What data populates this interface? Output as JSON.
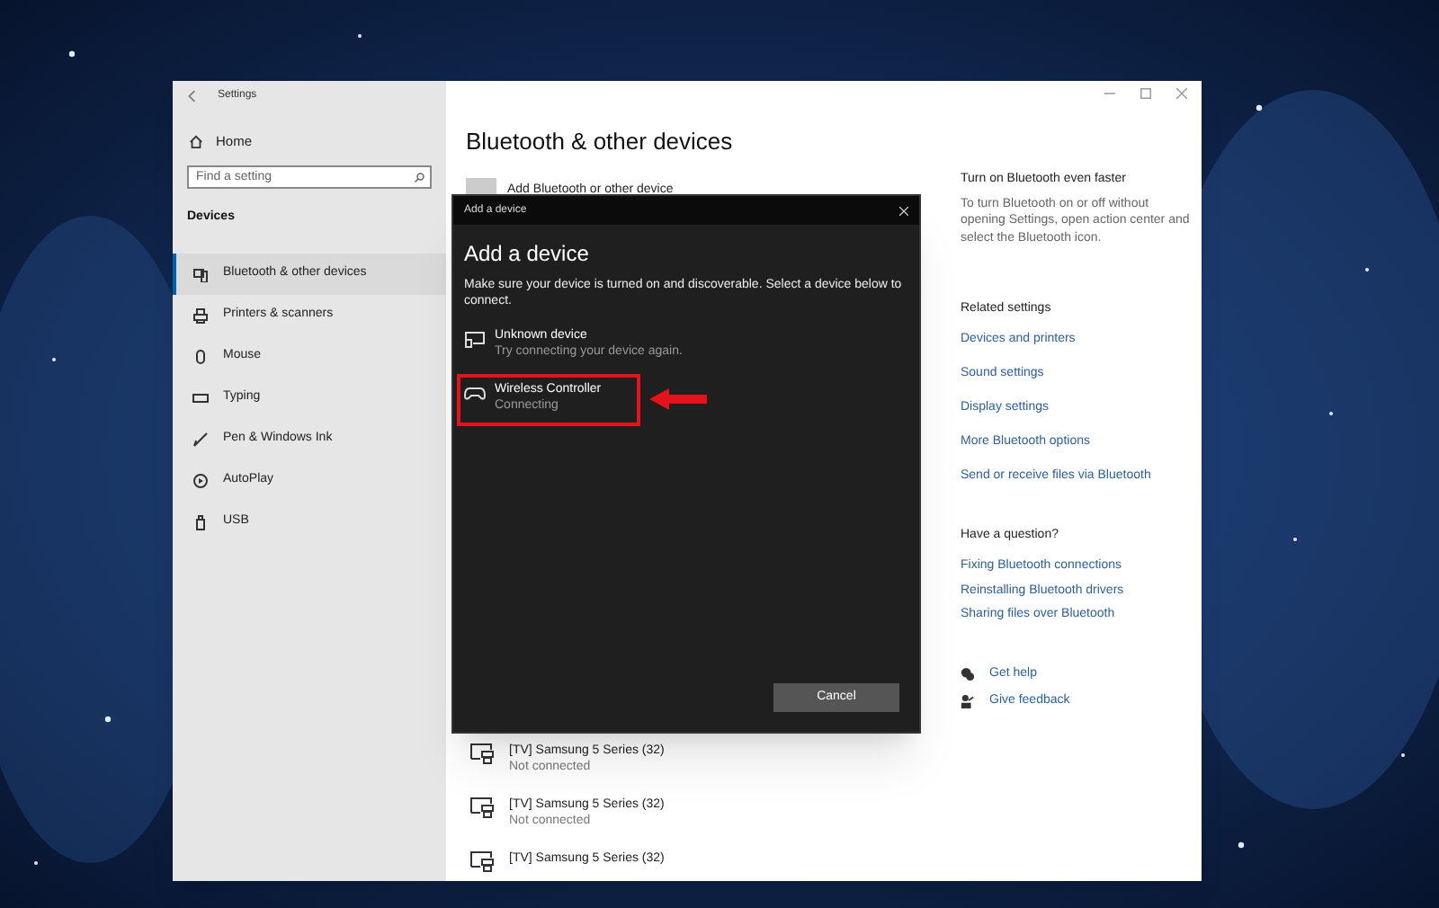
{
  "window": {
    "title": "Settings"
  },
  "sidebar": {
    "home": "Home",
    "search": {
      "placeholder": "Find a setting"
    },
    "section": "Devices",
    "items": [
      {
        "label": "Bluetooth & other devices",
        "selected": true
      },
      {
        "label": "Printers & scanners",
        "selected": false
      },
      {
        "label": "Mouse",
        "selected": false
      },
      {
        "label": "Typing",
        "selected": false
      },
      {
        "label": "Pen & Windows Ink",
        "selected": false
      },
      {
        "label": "AutoPlay",
        "selected": false
      },
      {
        "label": "USB",
        "selected": false
      }
    ]
  },
  "main": {
    "title": "Bluetooth & other devices",
    "add_button": "Add Bluetooth or other device",
    "devices": [
      {
        "name": "[TV] Samsung 5 Series (32)",
        "status": "Not connected"
      },
      {
        "name": "[TV] Samsung 5 Series (32)",
        "status": "Not connected"
      },
      {
        "name": "[TV] Samsung 5 Series (32)"
      }
    ]
  },
  "dialog": {
    "title": "Add a device",
    "heading": "Add a device",
    "instructions": "Make sure your device is turned on and discoverable. Select a device below to connect.",
    "devices": [
      {
        "kind": "display",
        "name": "Unknown device",
        "status": "Try connecting your device again.",
        "highlighted": false
      },
      {
        "kind": "gamepad",
        "name": "Wireless Controller",
        "status": "Connecting",
        "highlighted": true
      }
    ],
    "cancel": "Cancel"
  },
  "right": {
    "tip": {
      "title": "Turn on Bluetooth even faster",
      "text": "To turn Bluetooth on or off without opening Settings, open action center and select the Bluetooth icon."
    },
    "related": {
      "title": "Related settings",
      "links": [
        "Devices and printers",
        "Sound settings",
        "Display settings",
        "More Bluetooth options",
        "Send or receive files via Bluetooth"
      ]
    },
    "question": {
      "title": "Have a question?",
      "links": [
        "Fixing Bluetooth connections",
        "Reinstalling Bluetooth drivers",
        "Sharing files over Bluetooth"
      ]
    },
    "help": [
      "Get help",
      "Give feedback"
    ]
  }
}
